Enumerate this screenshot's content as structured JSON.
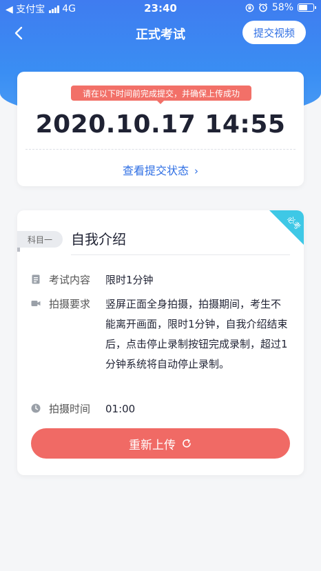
{
  "status_bar": {
    "app_back": "◀ 支付宝",
    "network": "4G",
    "time": "23:40",
    "battery": "58%"
  },
  "nav": {
    "title": "正式考试",
    "submit_video": "提交视频"
  },
  "deadline": {
    "tooltip": "请在以下时间前完成提交，并确保上传成功",
    "time": "2020.10.17 14:55",
    "status_link": "查看提交状态"
  },
  "subject": {
    "required_badge": "必考",
    "tag": "科目一",
    "title": "自我介绍",
    "rows": [
      {
        "label": "考试内容",
        "value": "限时1分钟",
        "icon": "document-icon"
      },
      {
        "label": "拍摄要求",
        "value": "竖屏正面全身拍摄，拍摄期间，考生不能离开画面，限时1分钟，自我介绍结束后，点击停止录制按钮完成录制，超过1分钟系统将自动停止录制。",
        "icon": "camera-icon"
      },
      {
        "label": "拍摄时间",
        "value": "01:00",
        "icon": "clock-icon"
      }
    ],
    "reupload": "重新上传"
  },
  "colors": {
    "primary_blue": "#3a8ef3",
    "link_blue": "#2f6fe4",
    "alert_red": "#f06a65",
    "ribbon_cyan": "#3ec8e6"
  }
}
